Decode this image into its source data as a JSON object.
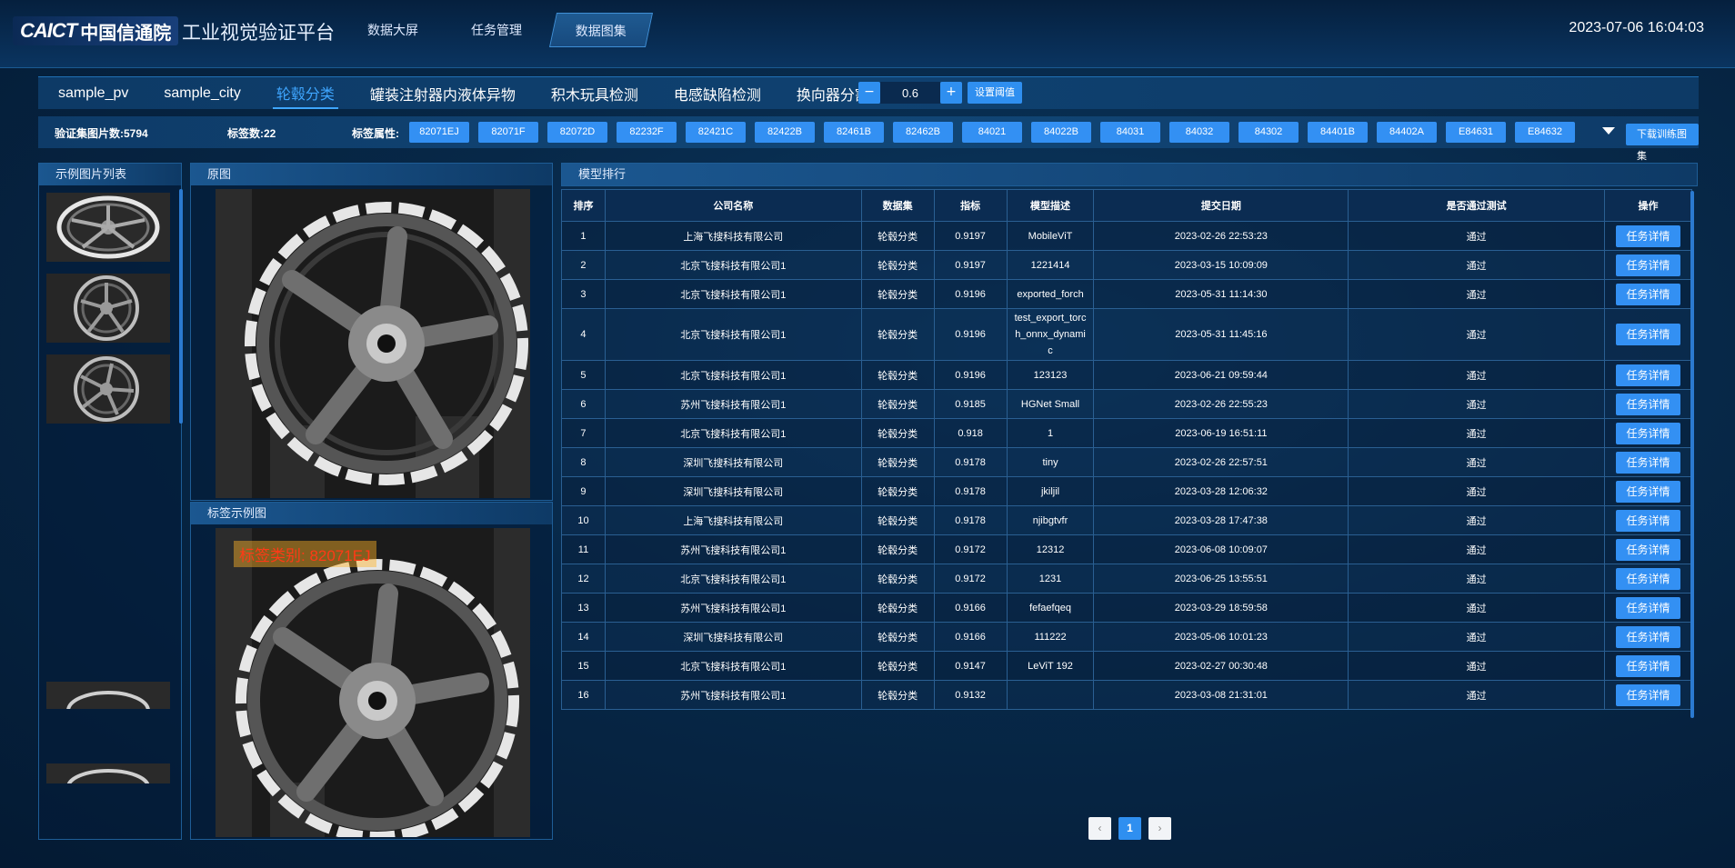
{
  "header": {
    "logo_en": "CAICT",
    "logo_cn": "中国信通院",
    "title": "工业视觉验证平台",
    "nav": [
      "数据大屏",
      "任务管理",
      "数据图集"
    ],
    "datetime": "2023-07-06 16:04:03"
  },
  "tabs": [
    "sample_pv",
    "sample_city",
    "轮毂分类",
    "罐装注射器内液体异物",
    "积木玩具检测",
    "电感缺陷检测",
    "换向器分割"
  ],
  "threshold": {
    "minus": "−",
    "value": "0.6",
    "plus": "+",
    "set_label": "设置阈值"
  },
  "info": {
    "image_count": "验证集图片数:5794",
    "label_count": "标签数:22",
    "attr_label": "标签属性:",
    "tags": [
      "82071EJ",
      "82071F",
      "82072D",
      "82232F",
      "82421C",
      "82422B",
      "82461B",
      "82462B",
      "84021",
      "84022B",
      "84031",
      "84032",
      "84302",
      "84401B",
      "84402A",
      "E84631",
      "E84632"
    ],
    "download": "下载训练图集"
  },
  "panels": {
    "thumbs_title": "示例图片列表",
    "original_title": "原图",
    "label_title": "标签示例图",
    "label_text": "标签类别: 82071EJ",
    "ranking_title": "模型排行"
  },
  "table": {
    "headers": [
      "排序",
      "公司名称",
      "数据集",
      "指标",
      "模型描述",
      "提交日期",
      "是否通过测试",
      "操作"
    ],
    "detail_label": "任务详情",
    "rows": [
      [
        "1",
        "上海飞搜科技有限公司",
        "轮毂分类",
        "0.9197",
        "MobileViT",
        "2023-02-26 22:53:23",
        "通过"
      ],
      [
        "2",
        "北京飞搜科技有限公司1",
        "轮毂分类",
        "0.9197",
        "1221414",
        "2023-03-15 10:09:09",
        "通过"
      ],
      [
        "3",
        "北京飞搜科技有限公司1",
        "轮毂分类",
        "0.9196",
        "exported_forch",
        "2023-05-31 11:14:30",
        "通过"
      ],
      [
        "4",
        "北京飞搜科技有限公司1",
        "轮毂分类",
        "0.9196",
        "test_export_torch_onnx_dynamic",
        "2023-05-31 11:45:16",
        "通过"
      ],
      [
        "5",
        "北京飞搜科技有限公司1",
        "轮毂分类",
        "0.9196",
        "123123",
        "2023-06-21 09:59:44",
        "通过"
      ],
      [
        "6",
        "苏州飞搜科技有限公司1",
        "轮毂分类",
        "0.9185",
        "HGNet Small",
        "2023-02-26 22:55:23",
        "通过"
      ],
      [
        "7",
        "北京飞搜科技有限公司1",
        "轮毂分类",
        "0.918",
        "1",
        "2023-06-19 16:51:11",
        "通过"
      ],
      [
        "8",
        "深圳飞搜科技有限公司",
        "轮毂分类",
        "0.9178",
        "tiny",
        "2023-02-26 22:57:51",
        "通过"
      ],
      [
        "9",
        "深圳飞搜科技有限公司",
        "轮毂分类",
        "0.9178",
        "jkiljil",
        "2023-03-28 12:06:32",
        "通过"
      ],
      [
        "10",
        "上海飞搜科技有限公司",
        "轮毂分类",
        "0.9178",
        "njibgtvfr",
        "2023-03-28 17:47:38",
        "通过"
      ],
      [
        "11",
        "苏州飞搜科技有限公司1",
        "轮毂分类",
        "0.9172",
        "12312",
        "2023-06-08 10:09:07",
        "通过"
      ],
      [
        "12",
        "北京飞搜科技有限公司1",
        "轮毂分类",
        "0.9172",
        "1231",
        "2023-06-25 13:55:51",
        "通过"
      ],
      [
        "13",
        "苏州飞搜科技有限公司1",
        "轮毂分类",
        "0.9166",
        "fefaefqeq",
        "2023-03-29 18:59:58",
        "通过"
      ],
      [
        "14",
        "深圳飞搜科技有限公司",
        "轮毂分类",
        "0.9166",
        "111222",
        "2023-05-06 10:01:23",
        "通过"
      ],
      [
        "15",
        "北京飞搜科技有限公司1",
        "轮毂分类",
        "0.9147",
        "LeViT 192",
        "2023-02-27 00:30:48",
        "通过"
      ],
      [
        "16",
        "苏州飞搜科技有限公司1",
        "轮毂分类",
        "0.9132",
        "",
        "2023-03-08 21:31:01",
        "通过"
      ]
    ]
  },
  "pager": {
    "prev": "‹",
    "current": "1",
    "next": "›"
  }
}
